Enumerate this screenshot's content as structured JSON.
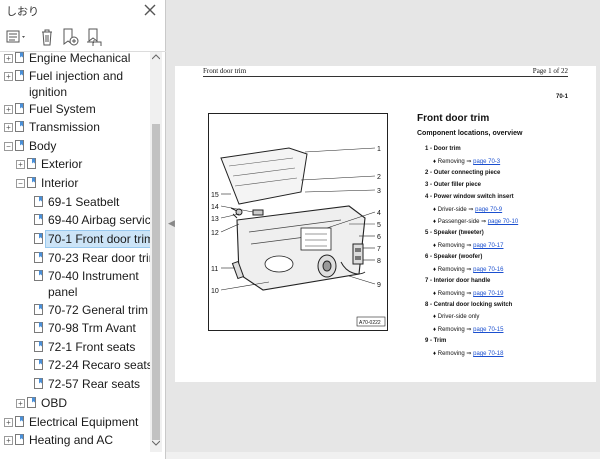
{
  "panel": {
    "title": "しおり",
    "tree": [
      {
        "label": "Engine Mechanical",
        "level": 0,
        "expanded": false
      },
      {
        "label": "Fuel injection and",
        "label2": "ignition",
        "level": 0,
        "expanded": false
      },
      {
        "label": "Fuel System",
        "level": 0,
        "expanded": false
      },
      {
        "label": "Transmission",
        "level": 0,
        "expanded": false
      },
      {
        "label": "Body",
        "level": 0,
        "expanded": true
      },
      {
        "label": "Exterior",
        "level": 1,
        "expanded": false
      },
      {
        "label": "Interior",
        "level": 1,
        "expanded": true
      },
      {
        "label": "69-1 Seatbelt",
        "level": 2
      },
      {
        "label": "69-40 Airbag service",
        "level": 2
      },
      {
        "label": "70-1 Front door trim",
        "level": 2,
        "selected": true
      },
      {
        "label": "70-23 Rear door trim",
        "level": 2
      },
      {
        "label": "70-40 Instrument",
        "label2": "panel",
        "level": 2
      },
      {
        "label": "70-72 General trim",
        "level": 2
      },
      {
        "label": "70-98 Trm Avant",
        "level": 2
      },
      {
        "label": "72-1 Front seats",
        "level": 2
      },
      {
        "label": "72-24 Recaro seats",
        "level": 2
      },
      {
        "label": "72-57 Rear seats",
        "level": 2
      },
      {
        "label": "OBD",
        "level": 1,
        "expanded": false
      },
      {
        "label": "Electrical Equipment",
        "level": 0,
        "expanded": false
      },
      {
        "label": "Heating and AC",
        "level": 0,
        "expanded": false
      }
    ],
    "toolbar_icons": [
      "options-menu-icon",
      "delete-icon",
      "new-bookmark-icon",
      "expand-bookmark-icon"
    ]
  },
  "page": {
    "header_left": "Front door trim",
    "header_right": "Page 1 of 22",
    "section": "70-1",
    "heading": "Front door trim",
    "subheading": "Component locations, overview",
    "figure_label": "A70-0222",
    "callouts": [
      "1",
      "2",
      "3",
      "4",
      "5",
      "6",
      "7",
      "8",
      "9",
      "10",
      "11",
      "12",
      "13",
      "14",
      "15"
    ],
    "items": [
      {
        "text": "1 - Door trim",
        "bold": true
      },
      {
        "text": "Removing ⇒ ",
        "link": "page 70-3",
        "sub": true
      },
      {
        "text": "2 - Outer connecting piece",
        "bold": true
      },
      {
        "text": "3 - Outer filler piece",
        "bold": true
      },
      {
        "text": "4 - Power window switch insert",
        "bold": true
      },
      {
        "text": "Driver-side ⇒ ",
        "link": "page 70-9",
        "sub": true
      },
      {
        "text": "Passenger-side ⇒ ",
        "link": "page 70-10",
        "sub": true
      },
      {
        "text": "5 - Speaker (tweeter)",
        "bold": true
      },
      {
        "text": "Removing ⇒ ",
        "link": "page 70-17",
        "sub": true
      },
      {
        "text": "6 - Speaker (woofer)",
        "bold": true
      },
      {
        "text": "Removing ⇒ ",
        "link": "page 70-16",
        "sub": true
      },
      {
        "text": "7 - Interior door handle",
        "bold": true
      },
      {
        "text": "Removing ⇒ ",
        "link": "page 70-19",
        "sub": true
      },
      {
        "text": "8 - Central door locking switch",
        "bold": true
      },
      {
        "text": "Driver-side only",
        "sub": true
      },
      {
        "text": "Removing ⇒ ",
        "link": "page 70-15",
        "sub": true
      },
      {
        "text": "9 - Trim",
        "bold": true
      },
      {
        "text": "Removing ⇒ ",
        "link": "page 70-18",
        "sub": true
      }
    ]
  },
  "colors": {
    "selection": "#cce4f7",
    "link": "#1a4fcf",
    "viewer_bg": "#e6e6e6"
  }
}
